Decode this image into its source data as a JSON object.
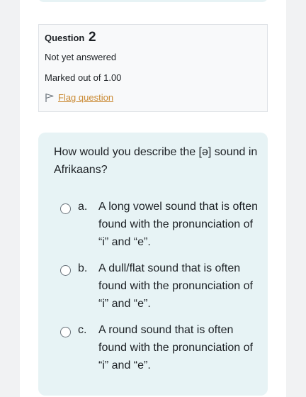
{
  "question_info": {
    "question_word": "Question",
    "question_number": "2",
    "state": "Not yet answered",
    "grade": "Marked out of 1.00",
    "flag_label": "Flag question"
  },
  "question": {
    "text": "How would you describe the [ə] sound in Afrikaans?",
    "options": [
      {
        "letter": "a.",
        "text": "A long vowel sound that is often found with the pronunciation of “i” and “e”.",
        "selected": false
      },
      {
        "letter": "b.",
        "text": "A dull/flat sound that is often found with the pronunciation of “i” and “e”.",
        "selected": false
      },
      {
        "letter": "c.",
        "text": "A round sound that is often found with the pronunciation of “i” and “e”.",
        "selected": false
      }
    ]
  },
  "colors": {
    "accent_link": "#ca8a33",
    "formulation_bg": "#e7f3f5",
    "info_bg": "#f8f9fa"
  }
}
